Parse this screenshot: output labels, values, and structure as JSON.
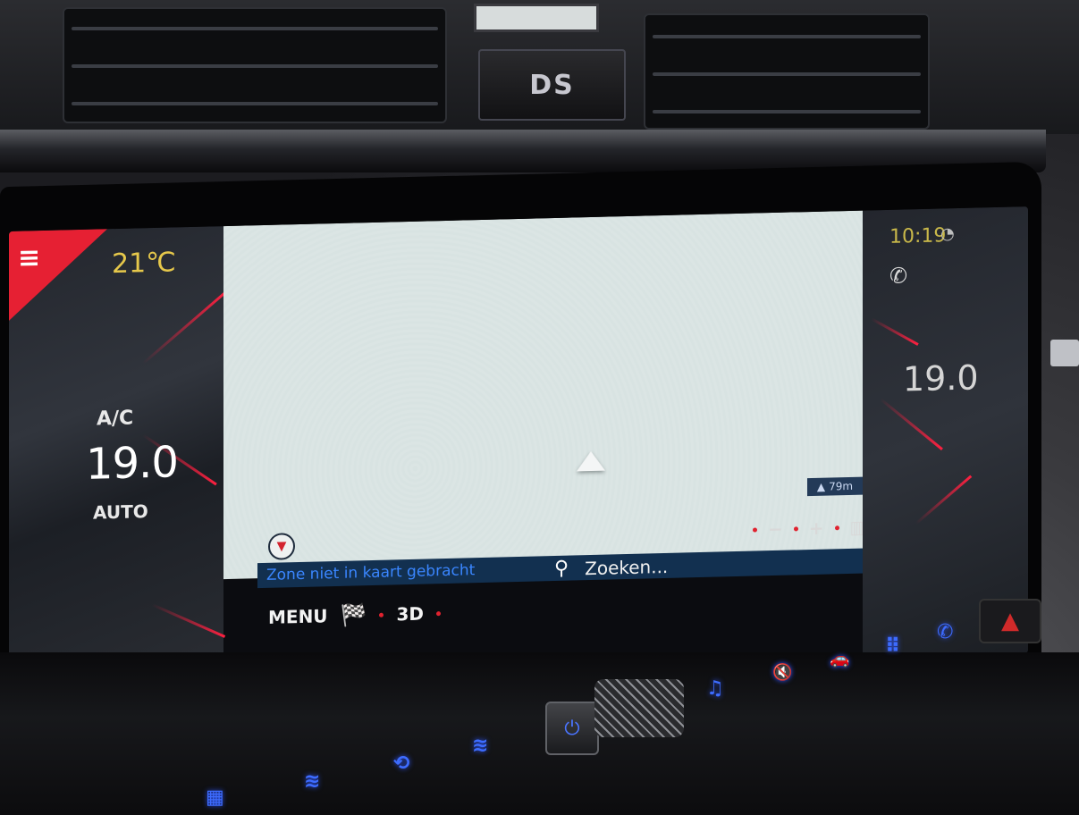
{
  "dashboard": {
    "brand_logo": "DS",
    "hard_keys": [
      {
        "name": "defrost-rear-icon",
        "glyph": "▦"
      },
      {
        "name": "seat-heat-icon",
        "glyph": "≋"
      },
      {
        "name": "recirculation-icon",
        "glyph": "⟲"
      },
      {
        "name": "seat-heat-right-icon",
        "glyph": "≋"
      },
      {
        "name": "music-icon",
        "glyph": "♫"
      },
      {
        "name": "mute-icon",
        "glyph": "🔇"
      },
      {
        "name": "car-icon",
        "glyph": "🚗"
      },
      {
        "name": "apps-icon",
        "glyph": "⠿"
      },
      {
        "name": "phone-icon",
        "glyph": "✆"
      }
    ],
    "power_glyph": "⏻",
    "hazard_glyph": "▲"
  },
  "screen": {
    "left": {
      "menu_glyph": "≡",
      "outside_temp": "21℃",
      "ac_label": "A/C",
      "cabin_temp_left": "19.0",
      "mode_left": "AUTO"
    },
    "map": {
      "status_text": "Zone niet in kaart gebracht",
      "scale_label": "79m",
      "search_placeholder": "Zoeken...",
      "compass_glyph": "▼",
      "zoom_minus": "−",
      "zoom_plus": "+"
    },
    "bottom": {
      "menu_label": "MENU",
      "flag_glyph": "🏁",
      "view_label": "3D"
    },
    "right": {
      "clock": "10:19",
      "cabin_temp_right": "19.0"
    }
  },
  "colors": {
    "accent_red": "#e62033",
    "button_blue": "#3d6cff",
    "temp_yellow": "#e6c84b",
    "status_blue": "#3a86ff"
  }
}
